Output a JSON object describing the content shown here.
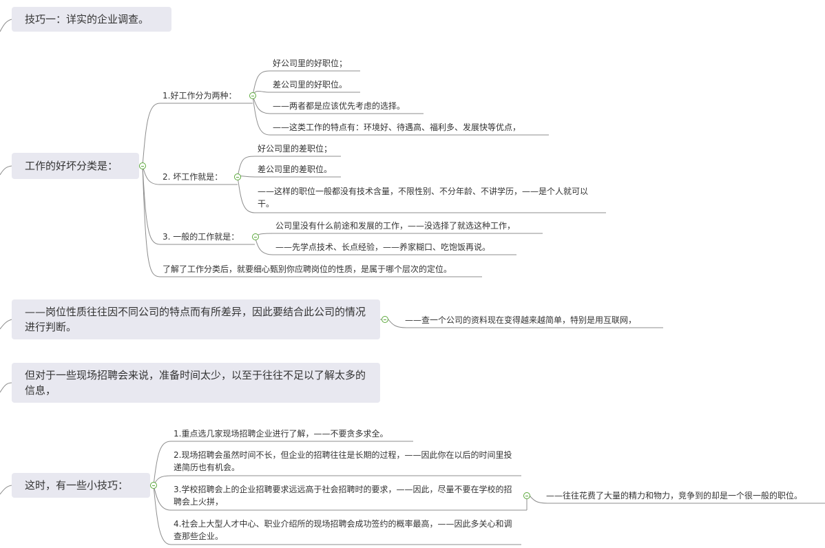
{
  "colors": {
    "line": "#8c8c8c",
    "box": "#e8e8f0",
    "toggle": "#5aa83a"
  },
  "topics": {
    "t1": "技巧一：详实的企业调查。",
    "t2": "工作的好坏分类是：",
    "t3": "——岗位性质往往因不同公司的特点而有所差异，因此要结合此公司的情况进行判断。",
    "t4": "但对于一些现场招聘会来说，准备时间太少，以至于往往不足以了解太多的信息，",
    "t5": "这时，有一些小技巧："
  },
  "good": {
    "label": "1.好工作分为两种：",
    "items": [
      "好公司里的好职位；",
      "差公司里的好职位。",
      "——两者都是应该优先考虑的选择。",
      "——这类工作的特点有：环境好、待遇高、福利多、发展快等优点，"
    ]
  },
  "bad": {
    "label": "2. 坏工作就是：",
    "items": [
      "好公司里的差职位；",
      "差公司里的差职位。",
      "——这样的职位一般都没有技术含量，不限性别、不分年龄、不讲学历，——是个人就可以干。"
    ]
  },
  "normal": {
    "label": "3. 一般的工作就是：",
    "items": [
      "公司里没有什么前途和发展的工作，——没选择了就选这种工作，",
      "——先学点技术、长点经验，——养家糊口、吃饱饭再说。"
    ]
  },
  "conclusion": "了解了工作分类后，就要细心甄别你应聘岗位的性质，是属于哪个层次的定位。",
  "internet": "——查一个公司的资料现在变得越来越简单，特别是用互联网，",
  "tips": [
    "1.重点选几家现场招聘企业进行了解，——不要贪多求全。",
    "2.现场招聘会虽然时间不长，但企业的招聘往往是长期的过程，——因此你在以后的时间里投递简历也有机会。",
    "3.学校招聘会上的企业招聘要求远远高于社会招聘时的要求，——因此，尽量不要在学校的招聘会上火拼，",
    "4.社会上大型人才中心、职业介绍所的现场招聘会成功签约的概率最高，——因此多关心和调查那些企业。"
  ],
  "tip3_note": "——往往花费了大量的精力和物力，竞争到的却是一个很一般的职位。"
}
